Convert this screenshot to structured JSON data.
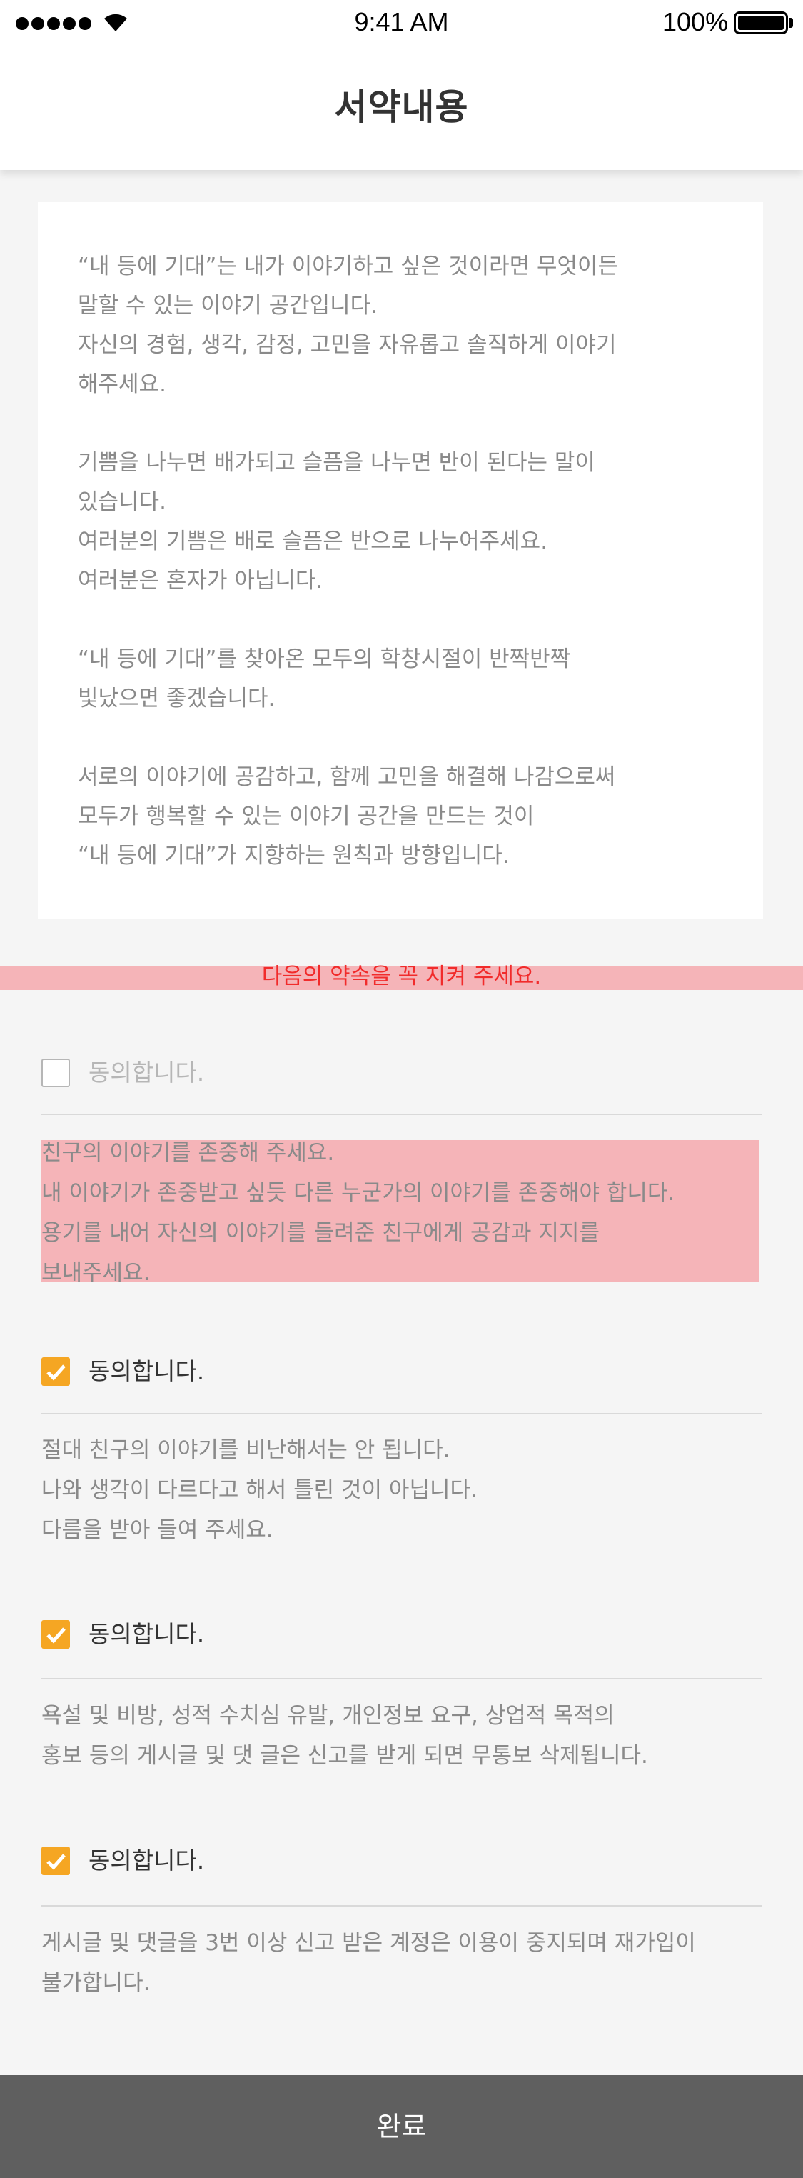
{
  "status_bar": {
    "time": "9:41 AM",
    "battery": "100%"
  },
  "header": {
    "title": "서약내용"
  },
  "intro": {
    "paragraphs": [
      "“내 등에 기대”는 내가 이야기하고 싶은 것이라면 무엇이든\n말할 수 있는 이야기 공간입니다.\n자신의 경험, 생각, 감정, 고민을 자유롭고 솔직하게 이야기\n해주세요.",
      "기쁨을 나누면 배가되고 슬픔을 나누면 반이 된다는 말이\n있습니다.\n여러분의 기쁨은 배로 슬픔은 반으로 나누어주세요.\n여러분은 혼자가 아닙니다.",
      "“내 등에 기대”를 찾아온 모두의 학창시절이 반짝반짝\n빛났으면 좋겠습니다.",
      "서로의 이야기에 공감하고, 함께 고민을 해결해 나감으로써\n모두가 행복할 수 있는 이야기 공간을 만드는 것이\n“내 등에 기대”가 지향하는 원칙과 방향입니다."
    ]
  },
  "notice": "다음의 약속을 꼭 지켜 주세요.",
  "agreements": [
    {
      "label": "동의합니다.",
      "checked": false
    },
    {
      "label": "동의합니다.",
      "checked": true
    },
    {
      "label": "동의합니다.",
      "checked": true
    },
    {
      "label": "동의합니다.",
      "checked": true
    }
  ],
  "rules": [
    "친구의 이야기를 존중해 주세요.\n내 이야기가 존중받고 싶듯 다른 누군가의 이야기를 존중해야 합니다.\n용기를 내어 자신의 이야기를 들려준 친구에게 공감과 지지를\n보내주세요.",
    "절대 친구의 이야기를 비난해서는 안 됩니다.\n나와 생각이 다르다고 해서 틀린 것이 아닙니다.\n다름을 받아 들여 주세요.",
    "욕설 및 비방, 성적 수치심 유발, 개인정보 요구, 상업적 목적의\n홍보 등의 게시글 및 댓 글은 신고를 받게 되면 무통보 삭제됩니다.",
    "게시글 및 댓글을 3번 이상 신고 받은 계정은 이용이 중지되며 재가입이\n불가합니다."
  ],
  "bottom_bar": {
    "done_label": "완료"
  },
  "colors": {
    "title": "#333333",
    "body_text": "#8A8A8A",
    "notice": "#F12B2B",
    "unchecked": "#B6B6B6",
    "divider": "#bababa",
    "background": "#f5f5f5",
    "bottom_bar": "#5f5f5f",
    "checkbox_checked": "#f5a623"
  },
  "icons": {
    "checked": "checkbox-checked-icon",
    "unchecked": "checkbox-unchecked-icon"
  }
}
